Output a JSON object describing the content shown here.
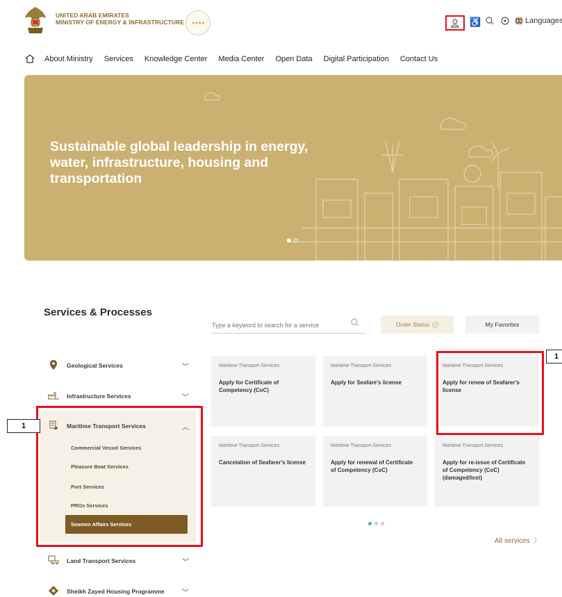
{
  "header": {
    "org_line1": "UNITED ARAB EMIRATES",
    "org_line2": "MINISTRY OF ENERGY & INFRASTRUCTURE",
    "language_label": "Languages",
    "icons": [
      "user-icon",
      "accessibility-icon",
      "search-icon",
      "settings-icon",
      "globe-icon"
    ]
  },
  "nav": {
    "items": [
      "About Ministry",
      "Services",
      "Knowledge Center",
      "Media Center",
      "Open Data",
      "Digital Participation",
      "Contact Us"
    ]
  },
  "banner": {
    "title": "Sustainable global leadership in energy, water, infrastructure, housing and transportation",
    "slides": 2,
    "active_slide": 1
  },
  "services": {
    "title": "Services & Processes",
    "search_placeholder": "Type a keyword to search for a service",
    "order_status_label": "Order Status",
    "favorites_label": "My Favorites",
    "sidebar": [
      {
        "label": "Geological Services",
        "icon": "map-pin-icon"
      },
      {
        "label": "Infrastructure Services",
        "icon": "factory-icon"
      },
      {
        "label": "Maritime Transport Services",
        "icon": "ship-icon",
        "expanded": true,
        "children": [
          "Commercial Vessel Services",
          "Pleasure Boat Services",
          "Port Services",
          "PROs Services",
          "Seamen Affairs Services"
        ],
        "active_child": "Seamen Affairs Services"
      },
      {
        "label": "Land Transport Services",
        "icon": "car-icon"
      },
      {
        "label": "Sheikh Zayed Housing Programme",
        "icon": "housing-icon"
      }
    ],
    "cards": [
      {
        "category": "Maritime Transport Services",
        "title": "Apply for Certificate of Competency (CoC)"
      },
      {
        "category": "Maritime Transport Services",
        "title": "Apply for Seafare's license"
      },
      {
        "category": "Maritime Transport Services",
        "title": "Apply for renew of Seafarer's license"
      },
      {
        "category": "Maritime Transport Services",
        "title": "Cancelation of Seafarer's license"
      },
      {
        "category": "Maritime Transport Services",
        "title": "Apply for renewal of Certificate of Competency (CoC)"
      },
      {
        "category": "Maritime Transport Services",
        "title": "Apply for re-issue of Certificate of Competency (CoC) (damaged/lost)"
      }
    ],
    "pager": {
      "pages": 3,
      "active": 1
    },
    "all_services_label": "All services"
  },
  "annotations": {
    "marker_left": "1",
    "marker_right": "1",
    "highlight_color": "#e8101c"
  },
  "colors": {
    "brand_gold": "#cbb071",
    "active_brown": "#7d5b24",
    "accent_text": "#8b6a31"
  }
}
